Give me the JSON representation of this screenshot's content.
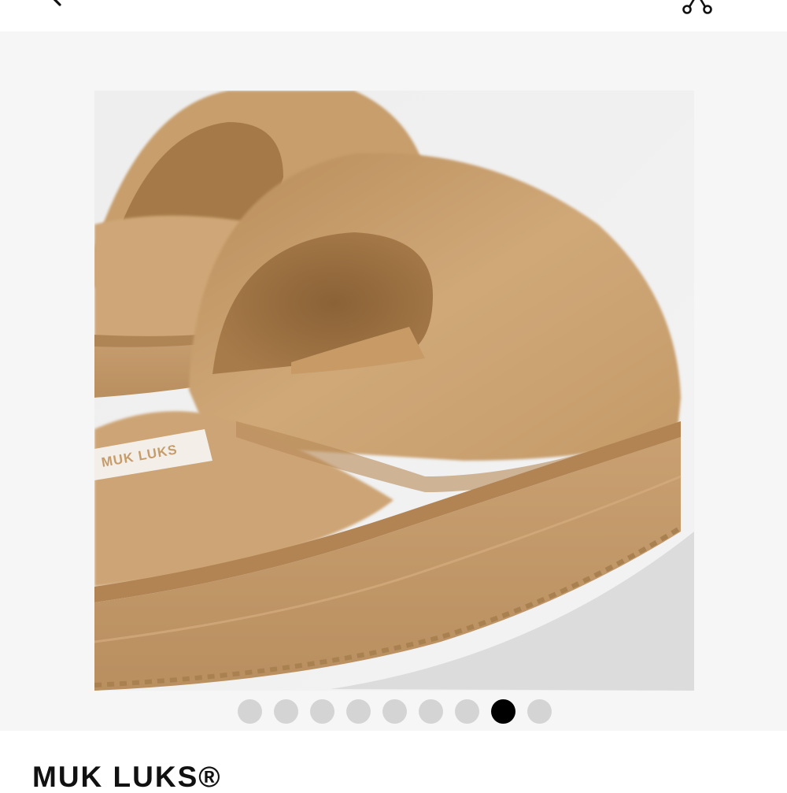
{
  "header": {
    "back_icon": "chevron-left-icon",
    "share_icon": "share-nodes-icon"
  },
  "gallery": {
    "image_alt": "Product photo",
    "image_count": 9,
    "active_index": 7,
    "logo_text": "MUK LUKS"
  },
  "product": {
    "brand": "MUK LUKS®"
  },
  "colors": {
    "background": "#ffffff",
    "gallery_bg": "#f6f6f6",
    "dot_inactive": "#d4d4d4",
    "dot_active": "#000000",
    "fur": "#c9a06e",
    "sole": "#c39a6b"
  }
}
